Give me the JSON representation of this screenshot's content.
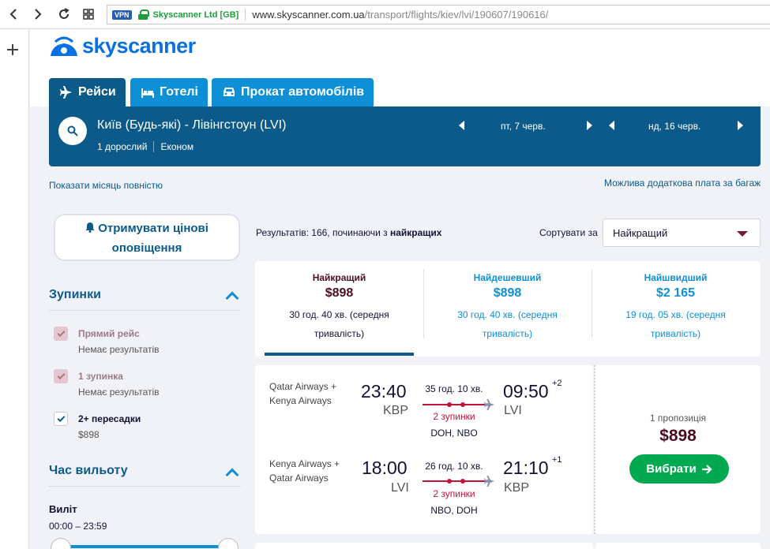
{
  "browser": {
    "vpn": "VPN",
    "company": "Skyscanner Ltd [GB]",
    "url_host": "www.skyscanner.com.ua",
    "url_path": "/transport/flights/kiev/lvi/190607/190616/"
  },
  "logo": {
    "text": "skyscanner"
  },
  "tabs": [
    {
      "label": "Рейси",
      "icon": "plane-icon"
    },
    {
      "label": "Готелі",
      "icon": "bed-icon"
    },
    {
      "label": "Прокат автомобілів",
      "icon": "car-icon"
    }
  ],
  "search": {
    "route": "Київ (Будь-які) - Лівінгстоун (LVI)",
    "passengers": "1 дорослий",
    "cabin": "Економ",
    "depart_date": "пт, 7 черв.",
    "return_date": "нд, 16 черв."
  },
  "links": {
    "show_month": "Показати місяць повністю",
    "baggage": "Можлива додаткова плата за багаж"
  },
  "sidebar": {
    "alert_button": "Отримувати цінові оповіщення",
    "stops_title": "Зупинки",
    "stops": [
      {
        "label": "Прямий рейс",
        "sub": "Немає результатів"
      },
      {
        "label": "1 зупинка",
        "sub": "Немає результатів"
      },
      {
        "label": "2+ пересадки",
        "sub": "$898"
      }
    ],
    "time_title": "Час вильоту",
    "departure_label": "Виліт",
    "departure_range": "00:00 – 23:59"
  },
  "results": {
    "prefix": "Результатів: 166, починаючи з ",
    "bold": "найкращих",
    "sort_label": "Сортувати за",
    "sort_value": "Найкращий"
  },
  "summary": [
    {
      "label": "Найкращий",
      "price": "$898",
      "duration": "30 год. 40 хв. (середня тривалість)"
    },
    {
      "label": "Найдешевший",
      "price": "$898",
      "duration": "30 год. 40 хв. (середня тривалість)"
    },
    {
      "label": "Найшвидший",
      "price": "$2 165",
      "duration": "19 год. 05 хв. (середня тривалість)"
    }
  ],
  "flight": {
    "outbound": {
      "airline": "Qatar Airways + Kenya Airways",
      "dep_time": "23:40",
      "dep_airport": "KBP",
      "duration": "35 год. 10 хв.",
      "stops": "2 зупинки",
      "via": "DOH, NBO",
      "arr_time": "09:50",
      "arr_airport": "LVI",
      "day_offset": "+2"
    },
    "inbound": {
      "airline": "Kenya Airways + Qatar Airways",
      "dep_time": "18:00",
      "dep_airport": "LVI",
      "duration": "26 год. 10 хв.",
      "stops": "2 зупинки",
      "via": "NBO, DOH",
      "arr_time": "21:10",
      "arr_airport": "KBP",
      "day_offset": "+1"
    },
    "offers": "1 пропозиція",
    "price": "$898",
    "select_label": "Вибрати"
  },
  "colors": {
    "brand": "#0770e3",
    "dark_blue": "#0b5a8a",
    "tab_blue": "#0e8fd6",
    "stop_red": "#c0143c",
    "select_green": "#00a84f",
    "price_dark": "#4c0e1f"
  }
}
